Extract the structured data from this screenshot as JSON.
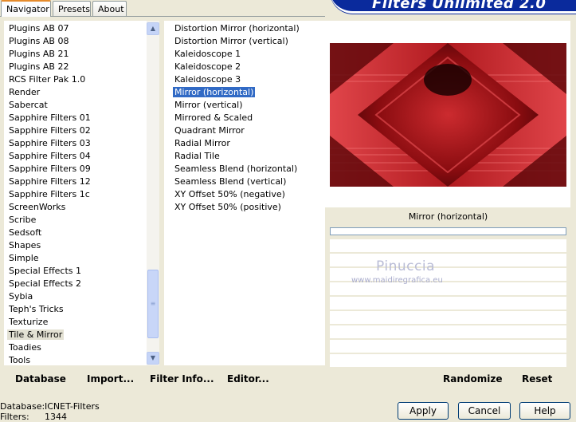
{
  "tabs": [
    "Navigator",
    "Presets",
    "About"
  ],
  "brand_title": "Filters Unlimited 2.0",
  "categories": [
    "Plugins AB 07",
    "Plugins AB 08",
    "Plugins AB 21",
    "Plugins AB 22",
    "RCS Filter Pak 1.0",
    "Render",
    "Sabercat",
    "Sapphire Filters 01",
    "Sapphire Filters 02",
    "Sapphire Filters 03",
    "Sapphire Filters 04",
    "Sapphire Filters 09",
    "Sapphire Filters 12",
    "Sapphire Filters 1c",
    "ScreenWorks",
    "Scribe",
    "Sedsoft",
    "Shapes",
    "Simple",
    "Special Effects 1",
    "Special Effects 2",
    "Sybia",
    "Teph's Tricks",
    "Texturize",
    "Tile & Mirror",
    "Toadies",
    "Tools"
  ],
  "selected_category": "Tile & Mirror",
  "filters": [
    "Distortion Mirror (horizontal)",
    "Distortion Mirror (vertical)",
    "Kaleidoscope 1",
    "Kaleidoscope 2",
    "Kaleidoscope 3",
    "Mirror (horizontal)",
    "Mirror (vertical)",
    "Mirrored & Scaled",
    "Quadrant Mirror",
    "Radial Mirror",
    "Radial Tile",
    "Seamless Blend (horizontal)",
    "Seamless Blend (vertical)",
    "XY Offset 50% (negative)",
    "XY Offset 50% (positive)"
  ],
  "selected_filter": "Mirror (horizontal)",
  "preview_caption": "Mirror (horizontal)",
  "watermark": {
    "name": "Pinuccia",
    "url": "www.maidiregrafica.eu"
  },
  "bottom_links": {
    "database": "Database",
    "import": "Import...",
    "filter_info": "Filter Info...",
    "editor": "Editor..."
  },
  "right_buttons": {
    "randomize": "Randomize",
    "reset": "Reset"
  },
  "status": {
    "database_label": "Database:",
    "database_value": "ICNET-Filters",
    "filters_label": "Filters:",
    "filters_value": "1344"
  },
  "dialog_buttons": {
    "apply": "Apply",
    "cancel": "Cancel",
    "help": "Help"
  },
  "scrollbar": {
    "up_icon": "scroll-up-icon",
    "down_icon": "scroll-down-icon"
  }
}
